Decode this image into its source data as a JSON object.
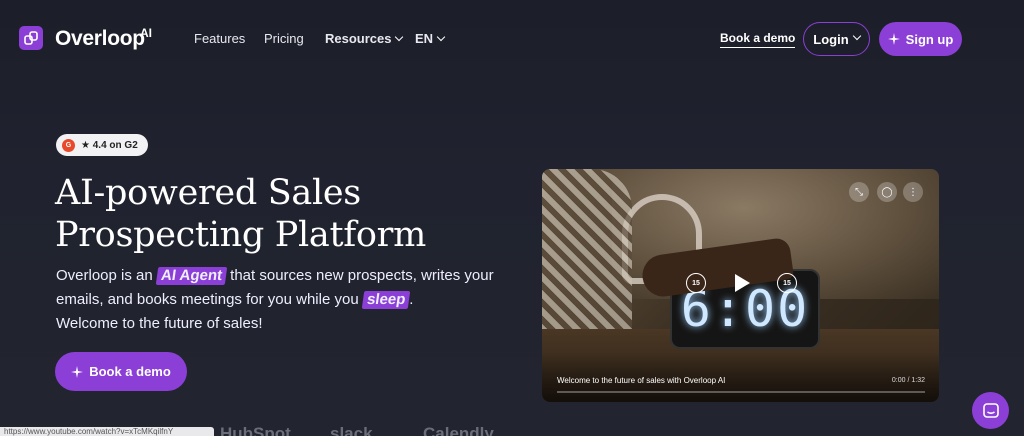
{
  "brand": {
    "name": "Overloop",
    "suffix": "AI",
    "accent": "#8b3fd6"
  },
  "nav": {
    "features": "Features",
    "pricing": "Pricing",
    "resources": "Resources",
    "language": "EN",
    "book_demo": "Book a demo",
    "login": "Login",
    "signup": "Sign up"
  },
  "hero": {
    "badge": "★ 4.4 on G2",
    "badge_icon": "G",
    "title_line1": "AI-powered Sales",
    "title_line2": "Prospecting Platform",
    "desc_1": "Overloop is an",
    "desc_hl1": "AI Agent",
    "desc_2": "that sources new prospects, writes your emails, and books meetings for you while you",
    "desc_hl2": "sleep",
    "desc_3": ".",
    "desc_4": "Welcome to the future of sales!",
    "cta": "Book a demo"
  },
  "video": {
    "clock": "6:00",
    "rewind": "15",
    "forward": "15",
    "caption": "Welcome to the future of sales with Overloop AI",
    "time": "0:00 / 1:32"
  },
  "logos": [
    "HubSpot",
    "slack",
    "Calendly"
  ],
  "status_url": "https://www.youtube.com/watch?v=xTcMKqilfnY"
}
